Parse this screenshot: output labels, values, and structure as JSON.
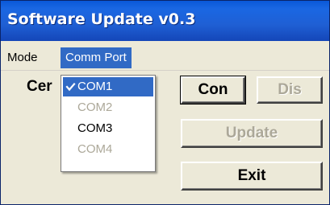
{
  "window": {
    "title": "Software Update v0.3"
  },
  "menubar": {
    "items": [
      {
        "label": "Mode"
      },
      {
        "label": "Comm Port"
      }
    ]
  },
  "main": {
    "status_label": "Cer",
    "buttons": {
      "connect": "Con",
      "disconnect": "Dis",
      "update": "Update",
      "exit": "Exit"
    }
  },
  "comm_port_menu": {
    "items": [
      {
        "label": "COM1",
        "checked": true,
        "enabled": true,
        "icon": "check-icon"
      },
      {
        "label": "COM2",
        "checked": false,
        "enabled": false
      },
      {
        "label": "COM3",
        "checked": false,
        "enabled": true
      },
      {
        "label": "COM4",
        "checked": false,
        "enabled": false
      }
    ]
  },
  "colors": {
    "titlebar": "#1f5fd4",
    "highlight": "#316ac5",
    "window_bg": "#ece9d8",
    "disabled_text": "#aca899"
  }
}
